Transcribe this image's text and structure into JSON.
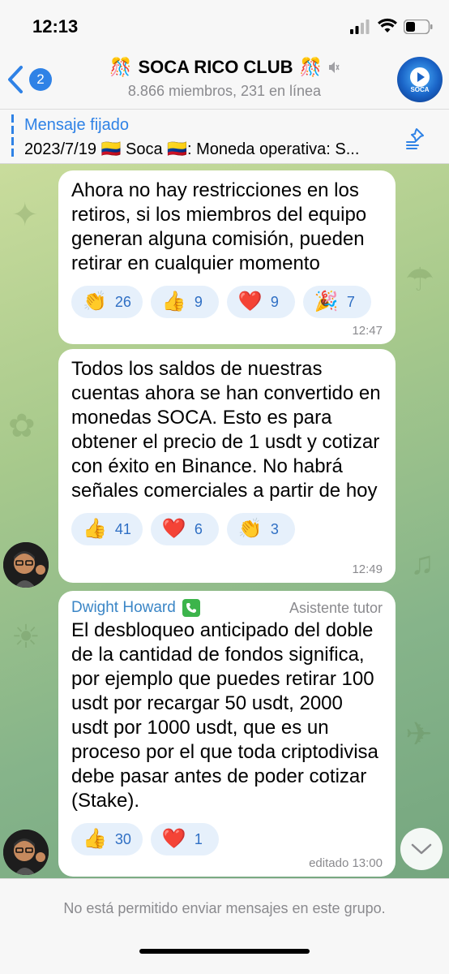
{
  "status_bar": {
    "time": "12:13"
  },
  "header": {
    "unread_count": "2",
    "title": "SOCA RICO CLUB",
    "title_emoji_left": "🎊",
    "title_emoji_right": "🎊",
    "subtitle": "8.866 miembros, 231 en línea",
    "avatar_brand": "SOCA"
  },
  "pinned": {
    "label": "Mensaje fijado",
    "text": "2023/7/19 🇨🇴 Soca 🇨🇴: Moneda operativa: S..."
  },
  "messages": [
    {
      "text": "Ahora no hay restricciones en los retiros, si los miembros del equipo generan alguna comisión, pueden retirar en cualquier momento",
      "reactions": [
        {
          "emoji": "👏",
          "count": "26"
        },
        {
          "emoji": "👍",
          "count": "9"
        },
        {
          "emoji": "❤️",
          "count": "9"
        },
        {
          "emoji": "🎉",
          "count": "7"
        }
      ],
      "time": "12:47"
    },
    {
      "text": "Todos los saldos de nuestras cuentas ahora se han convertido en monedas SOCA. Esto es para obtener el precio de 1 usdt y cotizar con éxito en Binance. No habrá señales comerciales a partir de hoy",
      "reactions": [
        {
          "emoji": "👍",
          "count": "41"
        },
        {
          "emoji": "❤️",
          "count": "6"
        },
        {
          "emoji": "👏",
          "count": "3"
        }
      ],
      "time": "12:49"
    },
    {
      "sender": "Dwight Howard",
      "role": "Asistente tutor",
      "text": "El desbloqueo anticipado del doble de la cantidad de fondos significa, por ejemplo que puedes retirar 100 usdt por  recargar  50 usdt, 2000 usdt por 1000 usdt, que es un proceso por el que toda criptodivisa debe pasar antes de poder cotizar (Stake).",
      "reactions": [
        {
          "emoji": "👍",
          "count": "30"
        },
        {
          "emoji": "❤️",
          "count": "1"
        }
      ],
      "time": "editado 13:00"
    }
  ],
  "footer": {
    "text": "No está permitido enviar mensajes en este grupo."
  },
  "colors": {
    "accent": "#2f82e6",
    "reaction_bg": "#e6f0fb",
    "chat_bg": "#a7c98c"
  }
}
